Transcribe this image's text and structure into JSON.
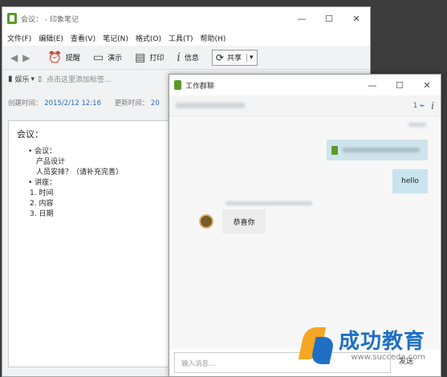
{
  "main_window": {
    "title": "会议： - 印象笔记",
    "menu": [
      "文件(F)",
      "编辑(E)",
      "查看(V)",
      "笔记(N)",
      "格式(O)",
      "工具(T)",
      "帮助(H)"
    ],
    "toolbar": {
      "remind": "提醒",
      "present": "演示",
      "print": "打印",
      "info": "信息",
      "share": "共享"
    },
    "notebook": "娱乐",
    "tag_placeholder": "点击这里添加标签...",
    "created_label": "创建时间：",
    "created_value": "2015/2/12 12:16",
    "updated_label": "更新时间：",
    "updated_value": "20",
    "note": {
      "title": "会议：",
      "line1": "• 会议：",
      "line2": "产品设计",
      "line3": "人员安排？（请补充完善）",
      "line4": "• 讲座：",
      "line5": "1. 时间",
      "line6": "2. 内容",
      "line7": "3. 日期"
    }
  },
  "chat_window": {
    "title": "工作群聊",
    "member_count": "1",
    "messages": {
      "sent": "hello",
      "received": "恭喜你"
    },
    "input_placeholder": "输入消息...",
    "send_label": "发送"
  },
  "watermark": {
    "brand": "成功教育",
    "url": "www.succeda.com"
  }
}
